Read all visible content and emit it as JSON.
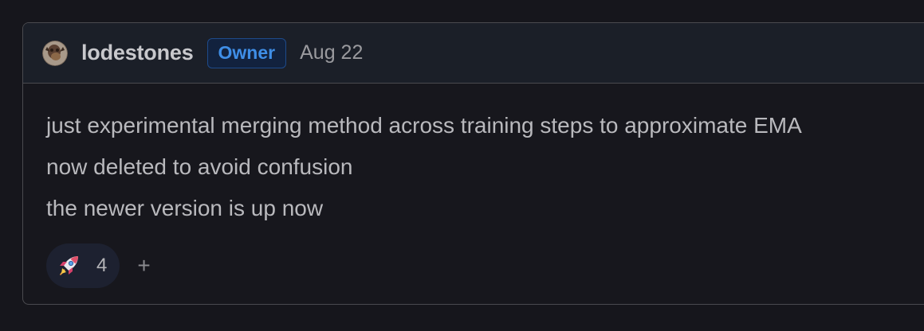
{
  "comment": {
    "author": "lodestones",
    "role_badge": "Owner",
    "date": "Aug 22",
    "avatar_icon": "user-avatar",
    "body_lines": [
      "just experimental merging method across training steps to approximate EMA",
      "now deleted to avoid confusion",
      "the newer version is up now"
    ],
    "reactions": [
      {
        "emoji_icon": "rocket-icon",
        "count": "4"
      }
    ],
    "add_reaction_label": "+"
  },
  "colors": {
    "background": "#16161c",
    "header_bg": "#1b1f28",
    "badge_text": "#3f8ee6",
    "badge_border": "#1e4a8a",
    "text_primary": "#b9b9bd"
  }
}
